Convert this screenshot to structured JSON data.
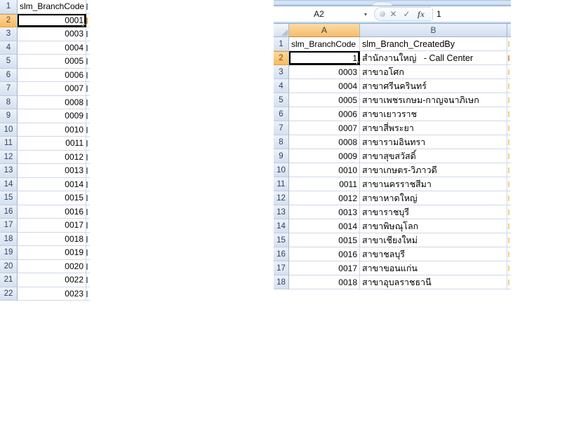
{
  "left_sheet": {
    "rows": [
      {
        "n": "1",
        "value": "slm_BranchCode",
        "align": "left"
      },
      {
        "n": "2",
        "value": "0001",
        "selected": true
      },
      {
        "n": "3",
        "value": "0003"
      },
      {
        "n": "4",
        "value": "0004"
      },
      {
        "n": "5",
        "value": "0005"
      },
      {
        "n": "6",
        "value": "0006"
      },
      {
        "n": "7",
        "value": "0007"
      },
      {
        "n": "8",
        "value": "0008"
      },
      {
        "n": "9",
        "value": "0009"
      },
      {
        "n": "10",
        "value": "0010"
      },
      {
        "n": "11",
        "value": "0011"
      },
      {
        "n": "12",
        "value": "0012"
      },
      {
        "n": "13",
        "value": "0013"
      },
      {
        "n": "14",
        "value": "0014"
      },
      {
        "n": "15",
        "value": "0015"
      },
      {
        "n": "16",
        "value": "0016"
      },
      {
        "n": "17",
        "value": "0017"
      },
      {
        "n": "18",
        "value": "0018"
      },
      {
        "n": "19",
        "value": "0019"
      },
      {
        "n": "20",
        "value": "0020"
      },
      {
        "n": "21",
        "value": "0022"
      },
      {
        "n": "22",
        "value": "0023"
      }
    ]
  },
  "excel": {
    "formula_bar": {
      "name_box": "A2",
      "value": "1"
    },
    "icons": {
      "dropdown": "▾",
      "cancel": "✕",
      "enter": "✓",
      "insert_function": "fx"
    },
    "columns": [
      {
        "label": "A",
        "selected": true
      },
      {
        "label": "B",
        "selected": false
      }
    ],
    "rows": [
      {
        "n": "1",
        "a": "slm_BranchCode",
        "b": "slm_Branch_CreatedBy",
        "a_align": "left"
      },
      {
        "n": "2",
        "a": "1",
        "b": "สำนักงานใหญ่   - Call Center",
        "selected": true
      },
      {
        "n": "3",
        "a": "0003",
        "b": "สาขาอโศก"
      },
      {
        "n": "4",
        "a": "0004",
        "b": "สาขาศรีนครินทร์"
      },
      {
        "n": "5",
        "a": "0005",
        "b": "สาขาเพชรเกษม-กาญจนาภิเษก"
      },
      {
        "n": "6",
        "a": "0006",
        "b": "สาขาเยาวราช"
      },
      {
        "n": "7",
        "a": "0007",
        "b": "สาขาสี่พระยา"
      },
      {
        "n": "8",
        "a": "0008",
        "b": "สาขารามอินทรา"
      },
      {
        "n": "9",
        "a": "0009",
        "b": "สาขาสุขสวัสดิ์"
      },
      {
        "n": "10",
        "a": "0010",
        "b": "สาขาเกษตร-วิภาวดี"
      },
      {
        "n": "11",
        "a": "0011",
        "b": "สาขานครราชสีมา"
      },
      {
        "n": "12",
        "a": "0012",
        "b": "สาขาหาดใหญ่"
      },
      {
        "n": "13",
        "a": "0013",
        "b": "สาขาราชบุรี"
      },
      {
        "n": "14",
        "a": "0014",
        "b": "สาขาพิษณุโลก"
      },
      {
        "n": "15",
        "a": "0015",
        "b": "สาขาเชียงใหม่"
      },
      {
        "n": "16",
        "a": "0016",
        "b": "สาขาชลบุรี"
      },
      {
        "n": "17",
        "a": "0017",
        "b": "สาขาขอนแก่น"
      },
      {
        "n": "18",
        "a": "0018",
        "b": "สาขาอุบลราชธานี"
      }
    ]
  },
  "colors": {
    "selected_header_bg": "#F8BB61",
    "selected_column_header_bg": "#F6BC6C",
    "header_bg": "#E4ECF7",
    "gridline": "#D0D7E5",
    "selection_border": "#000000",
    "ribbon_strip_blue": "#AFC9E6"
  }
}
